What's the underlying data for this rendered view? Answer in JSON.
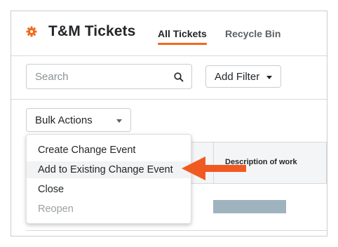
{
  "header": {
    "title": "T&M Tickets",
    "icon": "gear-icon",
    "accent_color": "#f06a20"
  },
  "tabs": [
    {
      "label": "All Tickets",
      "active": true
    },
    {
      "label": "Recycle Bin",
      "active": false
    }
  ],
  "search": {
    "placeholder": "Search",
    "value": "",
    "icon": "search-icon"
  },
  "filter": {
    "label": "Add Filter"
  },
  "bulk_actions": {
    "label": "Bulk Actions",
    "menu": [
      {
        "label": "Create Change Event",
        "disabled": false,
        "hovered": false
      },
      {
        "label": "Add to Existing Change Event",
        "disabled": false,
        "hovered": true
      },
      {
        "label": "Close",
        "disabled": false,
        "hovered": false
      },
      {
        "label": "Reopen",
        "disabled": true,
        "hovered": false
      }
    ]
  },
  "table": {
    "columns": [
      {
        "label": "Description of work"
      }
    ]
  },
  "annotation": {
    "type": "arrow",
    "color": "#f05a22",
    "points_to": "Add to Existing Change Event"
  }
}
